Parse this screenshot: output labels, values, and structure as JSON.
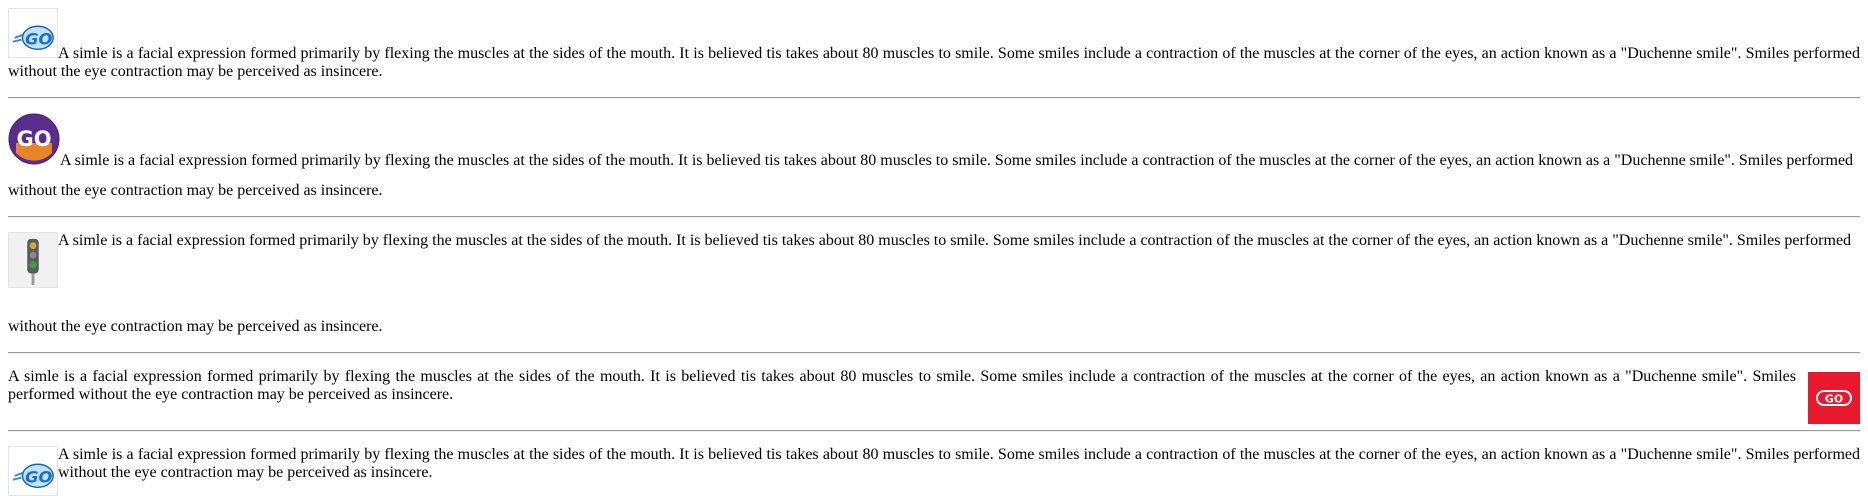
{
  "entries": [
    {
      "text": "A simle is a facial expression formed primarily by flexing the muscles at the sides of the mouth. It is believed tis takes about 80 muscles to smile. Some smiles include a contraction of the muscles at the corner of the eyes, an action known as a \"Duchenne smile\". Smiles performed without the eye contraction may be perceived as insincere.",
      "image": "go-cartoon-logo",
      "logo_text": "GO"
    },
    {
      "text_line1": "A simle is a facial expression formed primarily by flexing the muscles at the sides of the mouth. It is believed tis takes about 80 muscles to smile. Some smiles include a contraction of the muscles at the corner of the eyes, an action known as a \"Duchenne smile\". Smiles performed",
      "text_line2": "without the eye contraction may be perceived as insincere.",
      "image": "go-circle-logo",
      "logo_text": "GO"
    },
    {
      "text_line1": "A simle is a facial expression formed primarily by flexing the muscles at the sides of the mouth. It is believed tis takes about 80 muscles to smile. Some smiles include a contraction of the muscles at the corner of the eyes, an action known as a \"Duchenne smile\". Smiles performed",
      "text_line2": "without the eye contraction may be perceived as insincere.",
      "image": "traffic-light"
    },
    {
      "text": "A simle is a facial expression formed primarily by flexing the muscles at the sides of the mouth. It is believed tis takes about 80 muscles to smile. Some smiles include a contraction of the muscles at the corner of the eyes, an action known as a \"Duchenne smile\". Smiles performed without the eye contraction may be perceived as insincere.",
      "image": "red-go-logo",
      "logo_text": "GO"
    },
    {
      "text": "A simle is a facial expression formed primarily by flexing the muscles at the sides of the mouth. It is believed tis takes about 80 muscles to smile. Some smiles include a contraction of the muscles at the corner of the eyes, an action known as a \"Duchenne smile\". Smiles performed without the eye contraction may be perceived as insincere.",
      "image": "go-cartoon-logo",
      "logo_text": "GO"
    }
  ],
  "colors": {
    "cartoon_blue": "#2f8fe0",
    "circle_purple": "#5a2d8c",
    "circle_orange": "#f08a24",
    "red_logo": "#e8192c",
    "signal_green": "#3aa04a"
  }
}
